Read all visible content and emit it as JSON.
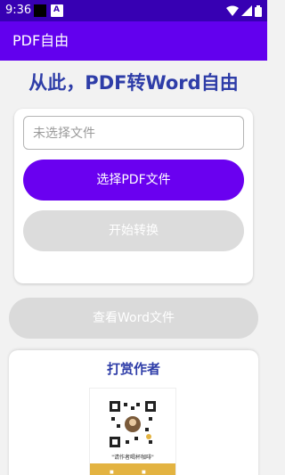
{
  "statusbar": {
    "time": "9:36",
    "icons": [
      "wifi-icon",
      "signal-icon",
      "battery-icon"
    ]
  },
  "appbar": {
    "title": "PDF自由"
  },
  "headline": "从此，PDF转Word自由",
  "converter": {
    "file_placeholder": "未选择文件",
    "select_button": "选择PDF文件",
    "start_button": "开始转换"
  },
  "view_button": "查看Word文件",
  "reward": {
    "title": "打赏作者",
    "qr_caption": "\"请作者喝杯咖啡\""
  },
  "colors": {
    "status_bar": "#3700b3",
    "app_bar": "#6200ee",
    "primary_button": "#6a00f0",
    "disabled_button": "#dcdcdc",
    "headline": "#2e3da8",
    "qr_bar": "#e3b341"
  }
}
